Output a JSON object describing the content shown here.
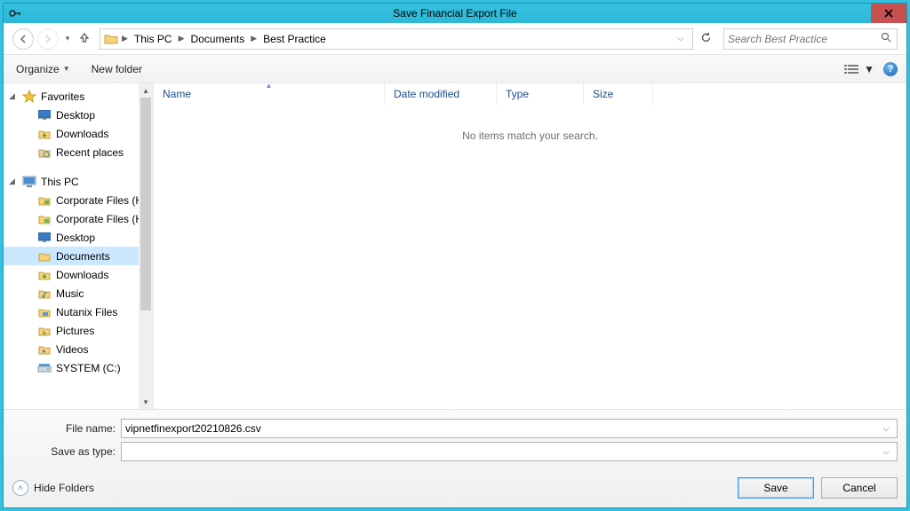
{
  "title": "Save Financial Export File",
  "breadcrumb": {
    "items": [
      "This PC",
      "Documents",
      "Best Practice"
    ]
  },
  "search": {
    "placeholder": "Search Best Practice"
  },
  "toolbar": {
    "organize": "Organize",
    "newfolder": "New folder"
  },
  "columns": {
    "name": "Name",
    "modified": "Date modified",
    "type": "Type",
    "size": "Size"
  },
  "empty_message": "No items match your search.",
  "nav": {
    "favorites": {
      "label": "Favorites",
      "items": [
        "Desktop",
        "Downloads",
        "Recent places"
      ]
    },
    "thispc": {
      "label": "This PC",
      "items": [
        "Corporate Files (H",
        "Corporate Files (H",
        "Desktop",
        "Documents",
        "Downloads",
        "Music",
        "Nutanix Files",
        "Pictures",
        "Videos",
        "SYSTEM (C:)"
      ],
      "selected": 3
    }
  },
  "form": {
    "filename_label": "File name:",
    "filename_value": "vipnetfinexport20210826.csv",
    "saveas_label": "Save as type:",
    "saveas_value": ""
  },
  "buttons": {
    "hide": "Hide Folders",
    "save": "Save",
    "cancel": "Cancel"
  }
}
